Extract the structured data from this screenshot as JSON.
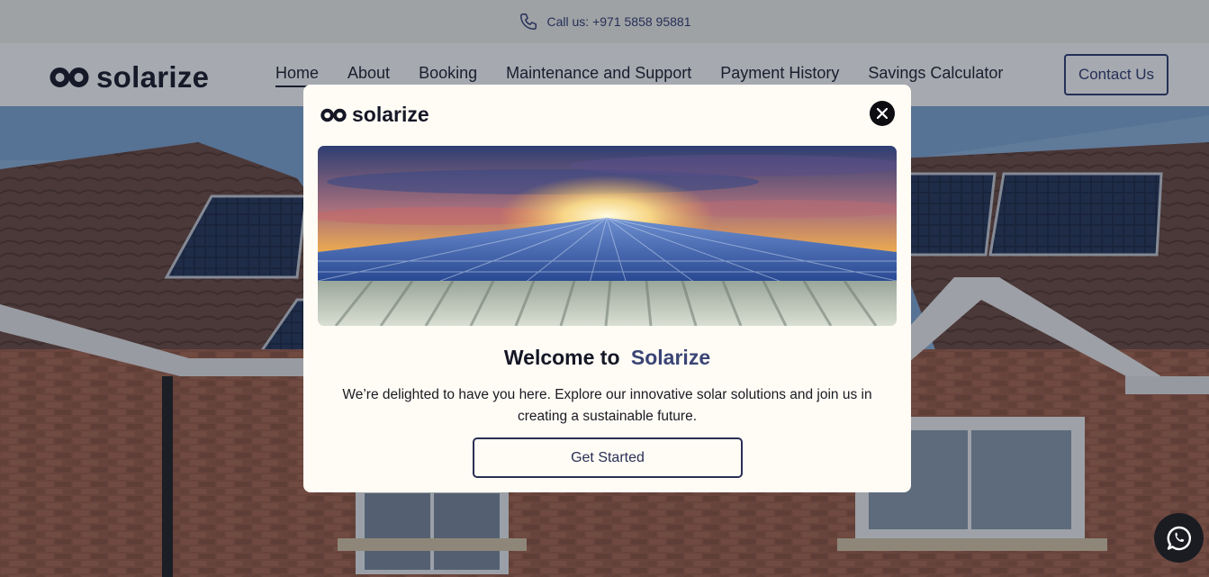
{
  "topbar": {
    "call_text": "Call us: +971 5858 95881",
    "icon": "phone-icon"
  },
  "header": {
    "logo_text": "solarize",
    "nav": [
      {
        "label": "Home",
        "active": true
      },
      {
        "label": "About"
      },
      {
        "label": "Booking"
      },
      {
        "label": "Maintenance and Support"
      },
      {
        "label": "Payment History"
      },
      {
        "label": "Savings Calculator"
      }
    ],
    "contact_label": "Contact Us"
  },
  "modal": {
    "logo_text": "solarize",
    "title_prefix": "Welcome to",
    "title_brand": "Solarize",
    "body": "We’re delighted to have you here. Explore our innovative solar solutions and join us in creating a sustainable future.",
    "button_label": "Get Started",
    "close_icon": "close-icon"
  },
  "floating": {
    "icon": "whatsapp-icon"
  },
  "colors": {
    "accent": "#2f3b73",
    "modal_bg": "#fffcf5",
    "dark": "#151726"
  }
}
